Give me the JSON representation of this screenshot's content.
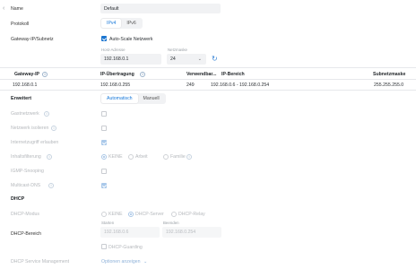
{
  "name": {
    "label": "Name",
    "value": "Default"
  },
  "protocol": {
    "label": "Protokoll",
    "options": [
      "IPv4",
      "IPv6"
    ],
    "selected": "IPv4"
  },
  "gateway": {
    "label": "Gateway-IP/Subnetz",
    "autoscale_label": "Auto-Scale Netzwerk",
    "host_label": "Host-Adresse",
    "host_value": "192.168.0.1",
    "netmask_label": "Netzmaske",
    "netmask_value": "24"
  },
  "table": {
    "headers": [
      "Gateway-IP",
      "IP-Übertragung",
      "Verwendbar...",
      "IP-Bereich",
      "Subnetzmaske"
    ],
    "row": [
      "192.168.0.1",
      "192.168.0.255",
      "249",
      "192.168.0.6 - 192.168.0.254",
      "255.255.255.0"
    ]
  },
  "advanced": {
    "label": "Erweitert",
    "tabs": [
      "Automatisch",
      "Manuell"
    ],
    "selected": "Automatisch"
  },
  "settings": {
    "gastnetzwerk": "Gastnetzwerk",
    "netzwerk_isolieren": "Netzwerk isolieren",
    "internetzugriff": "Internetzugriff erlauben",
    "inhaltsfilterung": "Inhaltsfilterung",
    "filter_options": [
      "KEINE",
      "Arbeit",
      "Familie"
    ],
    "igmp": "IGMP-Snooping",
    "multicast": "Multicast-DNS"
  },
  "dhcp": {
    "section": "DHCP",
    "mode_label": "DHCP-Modus",
    "mode_options": [
      "KEINE",
      "DHCP-Server",
      "DHCP-Relay"
    ],
    "range_label": "DHCP-Bereich",
    "start_label": "Starten",
    "start_value": "192.168.0.6",
    "end_label": "Beenden",
    "end_value": "192.168.0.254",
    "guarding_label": "DHCP-Guarding",
    "service_label": "DHCP Service Management",
    "show_options": "Optionen anzeigen"
  }
}
